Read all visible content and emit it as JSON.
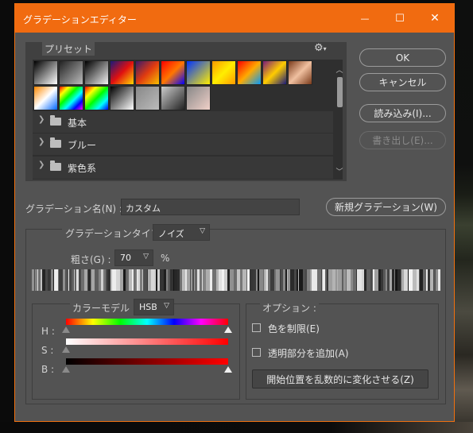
{
  "window": {
    "title": "グラデーションエディター",
    "controls": {
      "minimize": "—",
      "maximize": "☐",
      "close": "✕"
    }
  },
  "presets": {
    "label": "プリセット",
    "gear_icon": "gear-icon",
    "swatches_row1": [
      [
        "#000000",
        "#ffffff"
      ],
      [
        "#222222",
        "#bbbbbb"
      ],
      [
        "#000000",
        "#f2f2f2"
      ],
      [
        "#1a1a7a",
        "#e01010",
        "#ffd800"
      ],
      [
        "#3a1a6a",
        "#e03a10",
        "#f7c000"
      ],
      [
        "#ff0000",
        "#ff7700",
        "#0000ff"
      ],
      [
        "#0033ff",
        "#ffee00"
      ],
      [
        "#ff9900",
        "#ffee00",
        "#ff9900"
      ],
      [
        "#ff0000",
        "#ffaa00",
        "#0099ff"
      ],
      [
        "#7a1a7a",
        "#ffcc00",
        "#1a1a7a"
      ],
      [
        "#7a3a1a",
        "#f0c0a0",
        "#7a3a1a"
      ]
    ],
    "swatches_row2": [
      [
        "#ff8800",
        "#ffffff",
        "#0066ff"
      ],
      [
        "#ff0000",
        "#ffff00",
        "#00ff00",
        "#00ffff",
        "#0000ff",
        "#ff00ff"
      ],
      [
        "#ff0000",
        "#ffff00",
        "#00ff00",
        "#00ffff",
        "#0000ff"
      ],
      [
        "#000000",
        "#ffffff"
      ],
      [
        "#888888",
        "#bbbbbb"
      ],
      [
        "#cccccc",
        "#222222"
      ],
      [
        "#888888",
        "#f0d0c8"
      ]
    ],
    "folders": [
      "基本",
      "ブルー",
      "紫色系"
    ]
  },
  "buttons": {
    "ok": "OK",
    "cancel": "キャンセル",
    "load": "読み込み(I)...",
    "export": "書き出し(E)...",
    "new_gradient": "新規グラデーション(W)"
  },
  "gradient_name": {
    "label": "グラデーション名(N) :",
    "value": "カスタム"
  },
  "gradient_type": {
    "label": "グラデーションタイプ :",
    "value": "ノイズ"
  },
  "roughness": {
    "label": "粗さ(G) :",
    "value": "70",
    "unit": "%"
  },
  "color_model": {
    "label": "カラーモデル :",
    "value": "HSB",
    "channels": [
      "H :",
      "S :",
      "B :"
    ],
    "h_left_stop": 0.0,
    "h_right_stop": 1.0,
    "s_stop": 0.0,
    "b_left_stop": 0.0,
    "b_right_stop": 1.0
  },
  "options": {
    "label": "オプション :",
    "restrict_colors": "色を制限(E)",
    "add_transparency": "透明部分を追加(A)",
    "randomize": "開始位置を乱数的に変化させる(Z)",
    "restrict_checked": false,
    "transparency_checked": false
  }
}
